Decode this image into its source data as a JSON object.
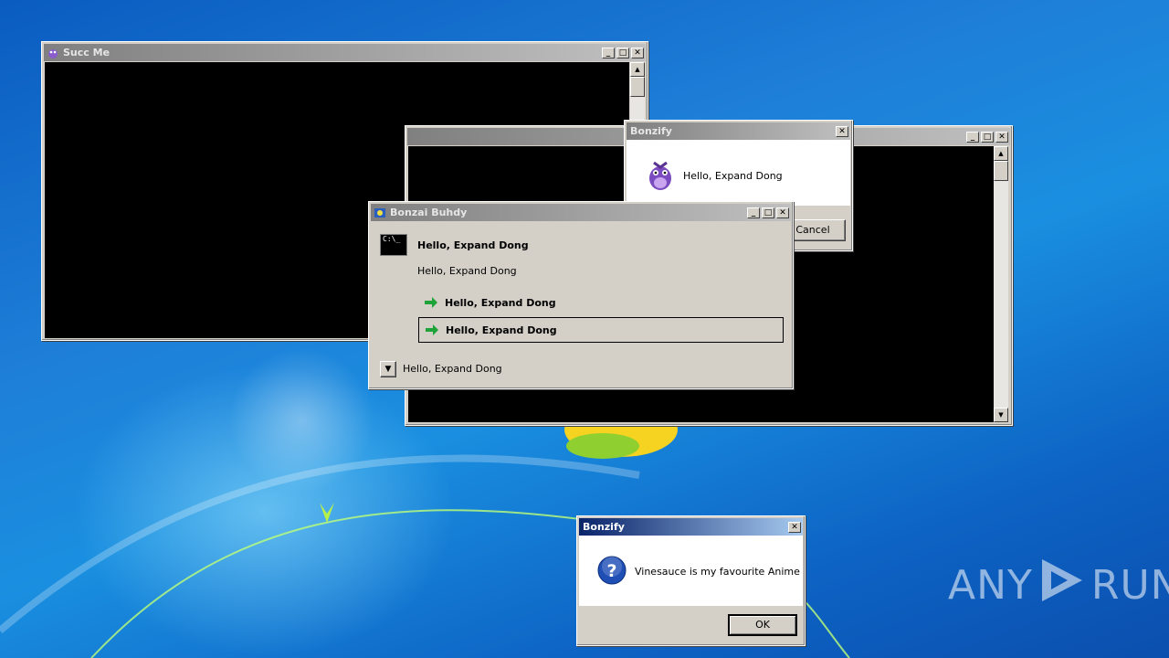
{
  "windows": {
    "succ_me": {
      "title": "Succ Me"
    },
    "back_console": {
      "title": ""
    },
    "bonzify_top": {
      "title": "Bonzify",
      "message": "Hello, Expand Dong",
      "cancel_label": "Cancel"
    },
    "bonzai_buhdy": {
      "title": "Bonzai Buhdy",
      "heading": "Hello, Expand Dong",
      "subtext": "Hello, Expand Dong",
      "links": [
        "Hello, Expand Dong",
        "Hello, Expand Dong"
      ],
      "expander_label": "Hello, Expand Dong"
    },
    "bonzify_bottom": {
      "title": "Bonzify",
      "message": "Vinesauce is my favourite Anime",
      "ok_label": "OK"
    }
  },
  "watermark": {
    "text_left": "ANY",
    "text_right": "RUN"
  },
  "icons": {
    "cmd_icon_text": "C:\\_",
    "close_glyph": "✕",
    "question_glyph": "?"
  },
  "colors": {
    "active_title": "#0a246a",
    "inactive_title": "#808080",
    "desktop": "#1e7fd8"
  }
}
